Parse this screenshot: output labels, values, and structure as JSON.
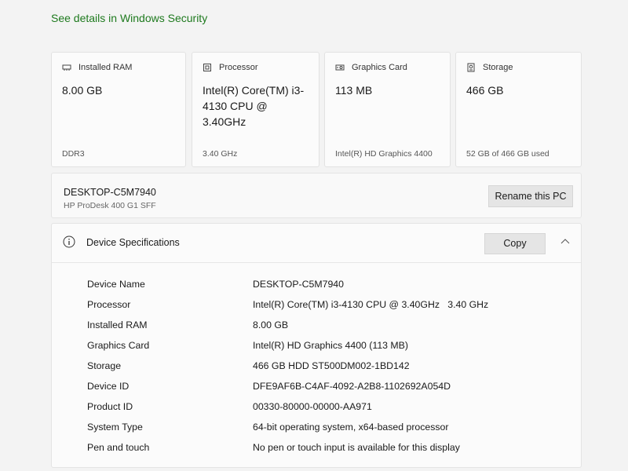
{
  "security_link": "See details in Windows Security",
  "cards": [
    {
      "label": "Installed RAM",
      "value": "8.00 GB",
      "sub": "DDR3",
      "icon": "ram-icon"
    },
    {
      "label": "Processor",
      "value": "Intel(R) Core(TM) i3-4130 CPU @ 3.40GHz",
      "sub": "3.40 GHz",
      "icon": "processor-icon"
    },
    {
      "label": "Graphics Card",
      "value": "113 MB",
      "sub": "Intel(R) HD Graphics 4400",
      "icon": "graphics-card-icon"
    },
    {
      "label": "Storage",
      "value": "466 GB",
      "sub": "52 GB of 466 GB used",
      "icon": "storage-icon"
    }
  ],
  "device": {
    "name": "DESKTOP-C5M7940",
    "model": "HP ProDesk 400 G1 SFF",
    "rename_label": "Rename this PC"
  },
  "specs": {
    "title": "Device Specifications",
    "copy_label": "Copy",
    "rows": [
      {
        "label": "Device Name",
        "value": "DESKTOP-C5M7940"
      },
      {
        "label": "Processor",
        "value": "Intel(R) Core(TM) i3-4130 CPU @ 3.40GHz   3.40 GHz"
      },
      {
        "label": "Installed RAM",
        "value": "8.00 GB"
      },
      {
        "label": "Graphics Card",
        "value": "Intel(R) HD Graphics 4400 (113 MB)"
      },
      {
        "label": "Storage",
        "value": "466 GB HDD ST500DM002-1BD142"
      },
      {
        "label": "Device ID",
        "value": "DFE9AF6B-C4AF-4092-A2B8-1102692A054D"
      },
      {
        "label": "Product ID",
        "value": "00330-80000-00000-AA971"
      },
      {
        "label": "System Type",
        "value": "64-bit operating system, x64-based processor"
      },
      {
        "label": "Pen and touch",
        "value": "No pen or touch input is available for this display"
      }
    ]
  },
  "colors": {
    "link": "#1e7a1e",
    "button": "#e5e5e5"
  }
}
